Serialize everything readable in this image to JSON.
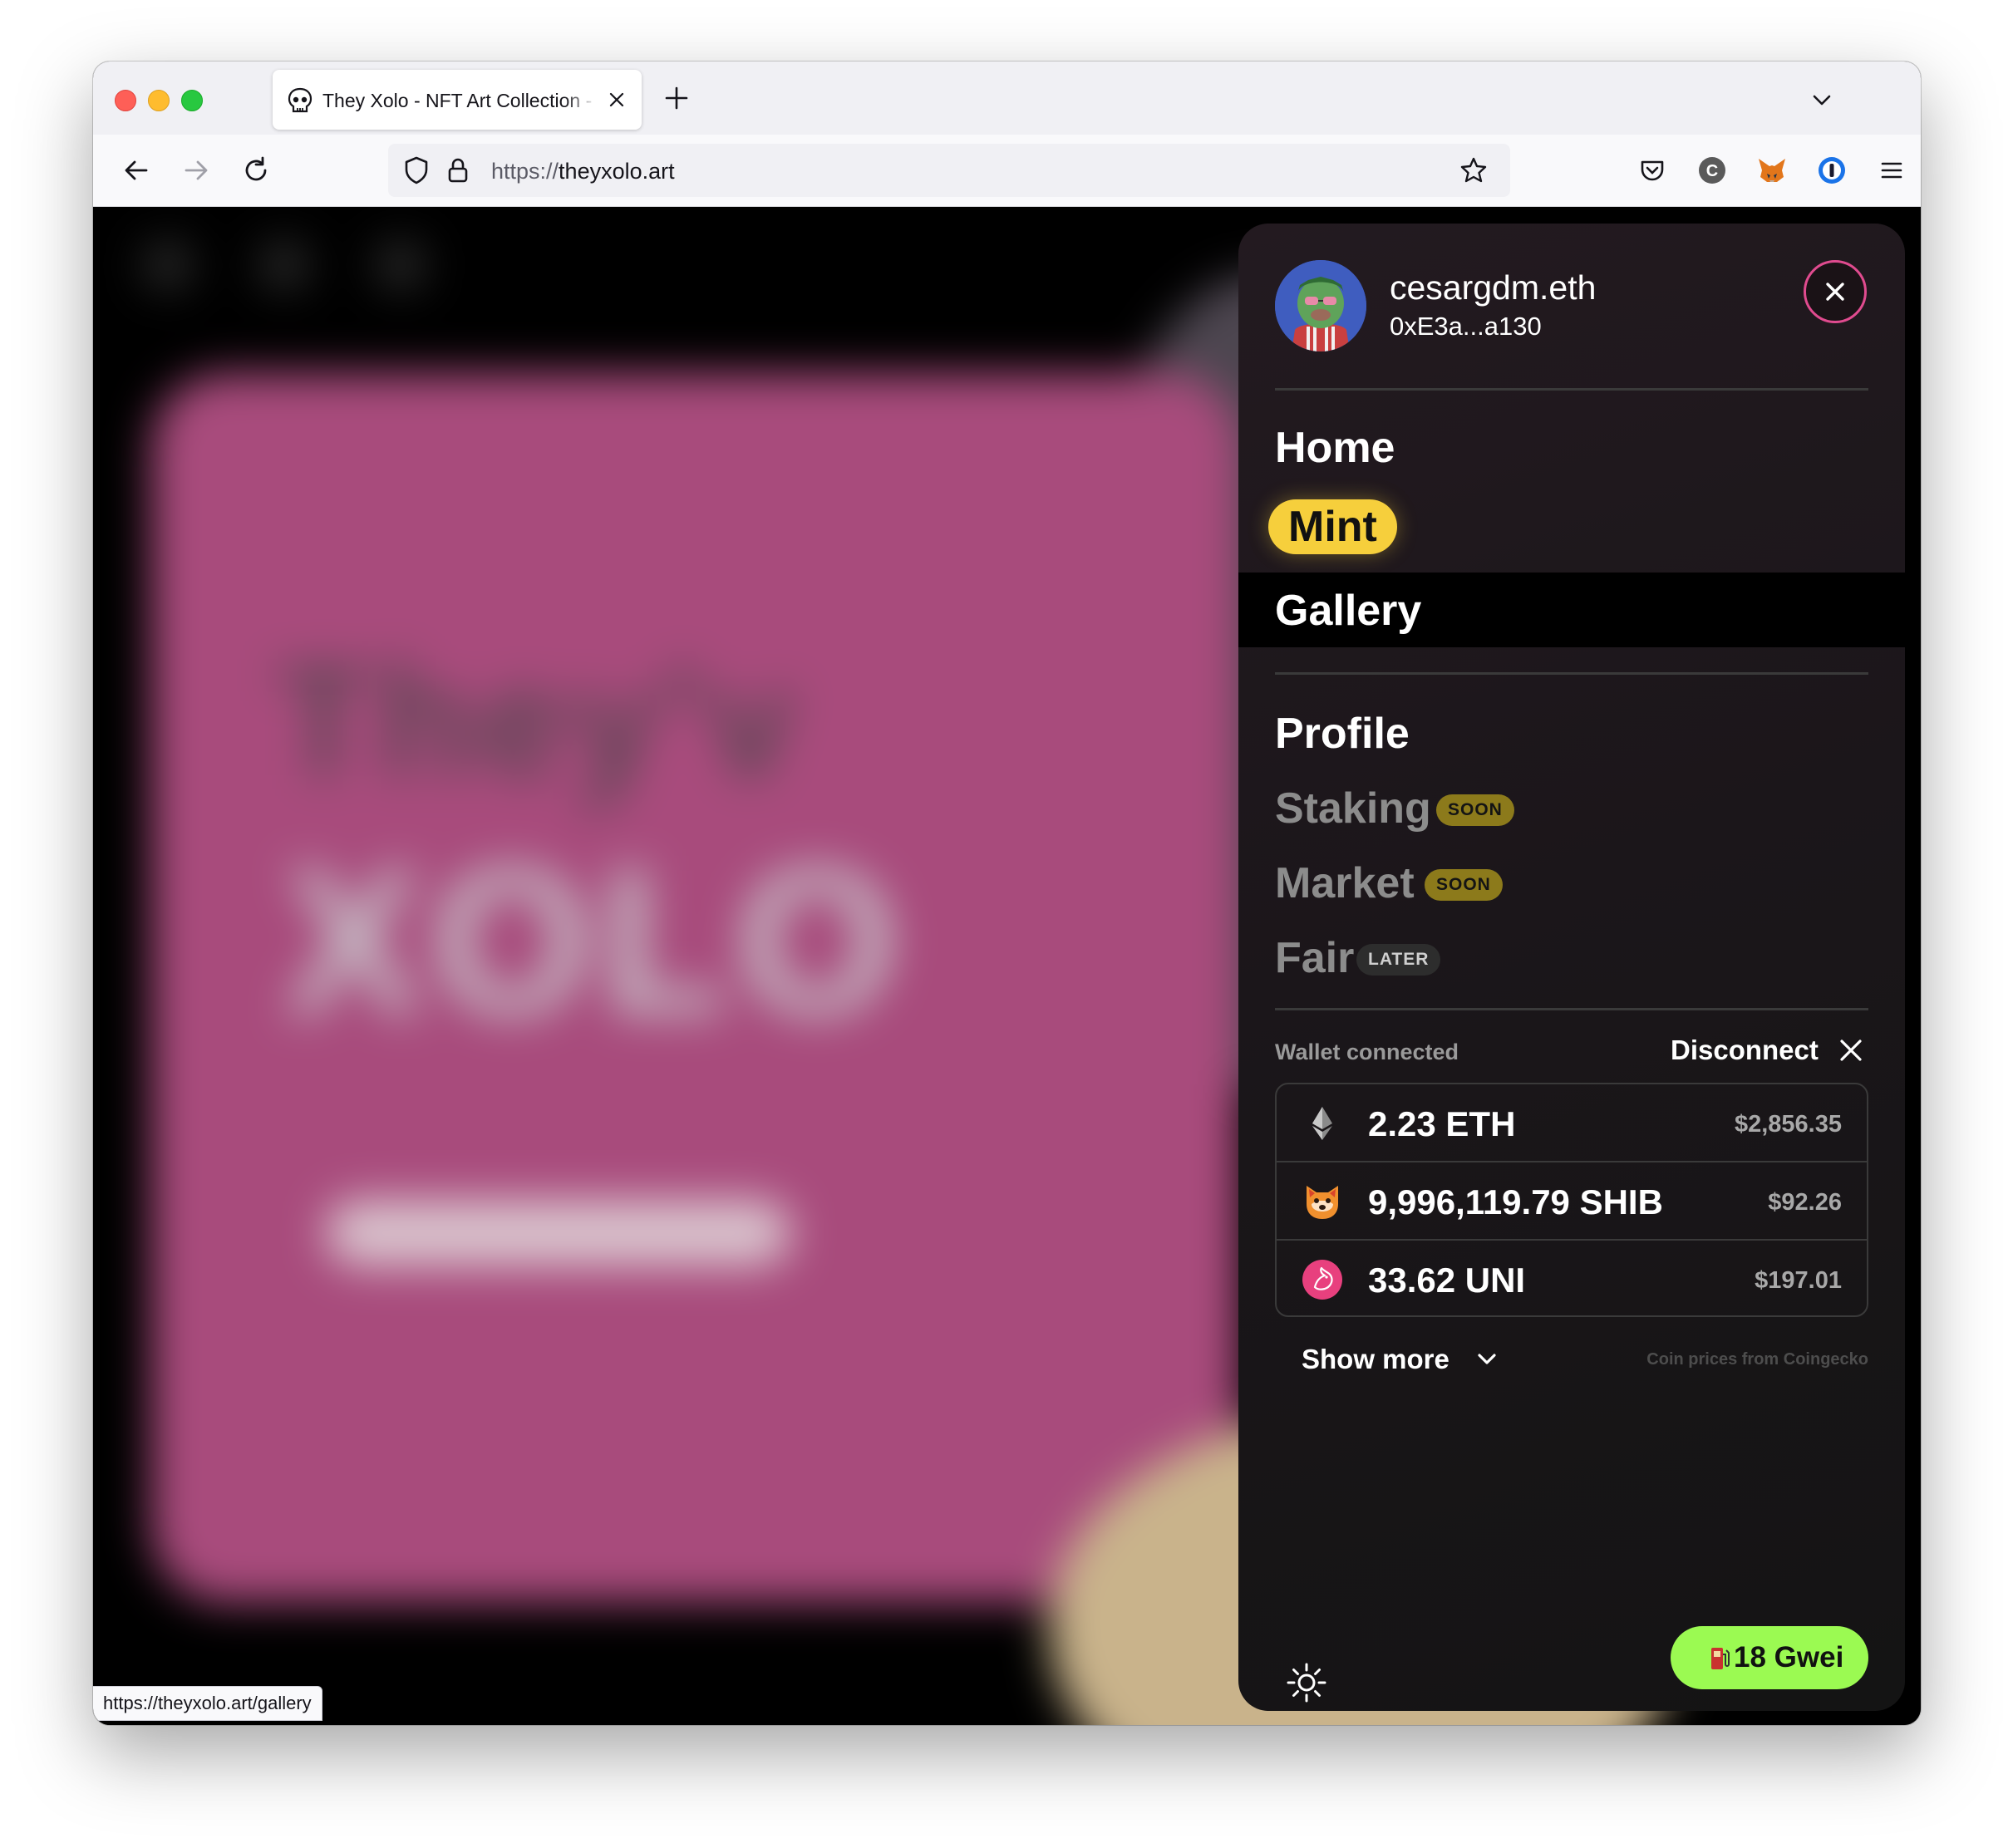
{
  "browser": {
    "tab_title": "They Xolo - NFT Art Collection - ",
    "url_scheme": "https://",
    "url_host": "theyxolo.art",
    "status_link": "https://theyxolo.art/gallery"
  },
  "background_art": {
    "title_line1": "They'v",
    "title_line2": "XOLO"
  },
  "account": {
    "ens_name": "cesargdm.eth",
    "address": "0xE3a...a130"
  },
  "nav": {
    "home": "Home",
    "mint": "Mint",
    "gallery": "Gallery",
    "profile": "Profile",
    "staking": "Staking",
    "staking_badge": "SOON",
    "market": "Market",
    "market_badge": "SOON",
    "fair": "Fair",
    "fair_badge": "LATER"
  },
  "wallet": {
    "status_label": "Wallet connected",
    "disconnect_label": "Disconnect",
    "tokens": [
      {
        "amount": "2.23 ETH",
        "usd": "$2,856.35",
        "icon": "ethereum-icon"
      },
      {
        "amount": "9,996,119.79 SHIB",
        "usd": "$92.26",
        "icon": "shiba-icon"
      },
      {
        "amount": "33.62 UNI",
        "usd": "$197.01",
        "icon": "uniswap-icon"
      }
    ],
    "show_more_label": "Show more",
    "price_source": "Coin prices from Coingecko"
  },
  "footer": {
    "gas_label": "18 Gwei"
  },
  "colors": {
    "accent_pink": "#e04b8f",
    "mint_yellow": "#f6cf3c",
    "gas_green": "#9bfa52"
  }
}
